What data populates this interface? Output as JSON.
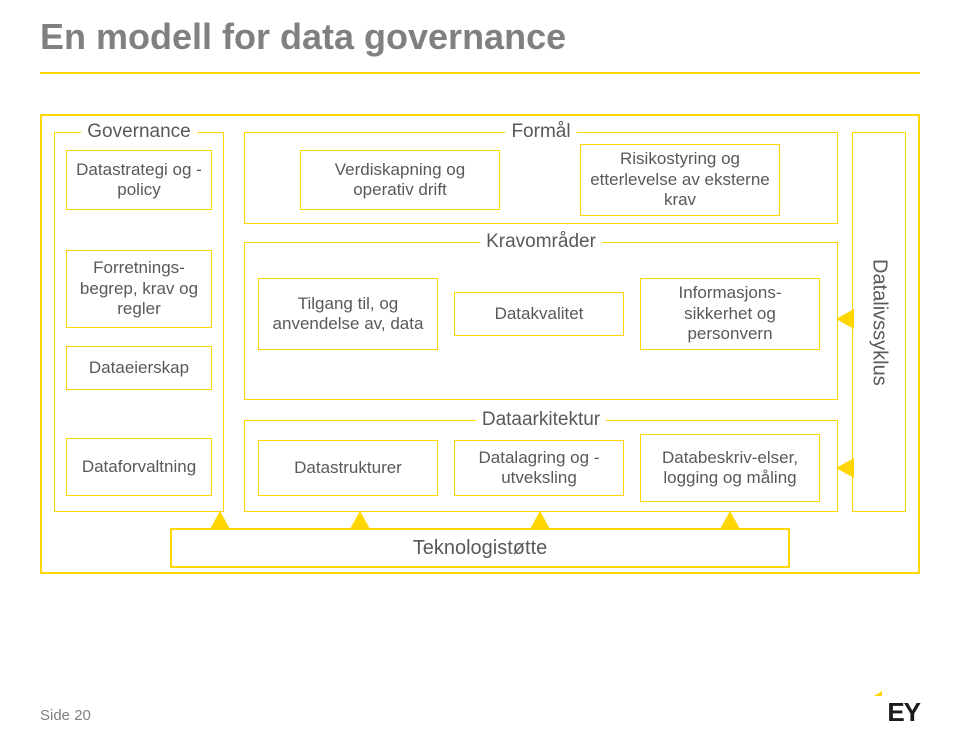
{
  "colors": {
    "accent": "#ffd600",
    "text": "#595959",
    "title": "#808080"
  },
  "title": "En modell for data governance",
  "groups": {
    "governance": {
      "head": "Governance"
    },
    "formal": {
      "head": "Formål"
    },
    "krav": {
      "head": "Kravområder"
    },
    "arkitektur": {
      "head": "Dataarkitektur"
    }
  },
  "boxes": {
    "strategy": "Datastrategi og\n-policy",
    "value": "Verdiskapning og operativ drift",
    "risk": "Risikostyring og etterlevelse av eksterne krav",
    "concepts": "Forretnings-begrep, krav og regler",
    "ownership": "Dataeierskap",
    "access": "Tilgang til, og anvendelse av, data",
    "quality": "Datakvalitet",
    "security": "Informasjons-sikkerhet og personvern",
    "mgmt": "Dataforvaltning",
    "structures": "Datastrukturer",
    "storage": "Datalagring og\n-utveksling",
    "descriptions": "Databeskriv-elser, logging og måling"
  },
  "lifecycle": "Datalivssyklus",
  "tech": "Teknologistøtte",
  "footer": "Side 20",
  "logo": "EY"
}
